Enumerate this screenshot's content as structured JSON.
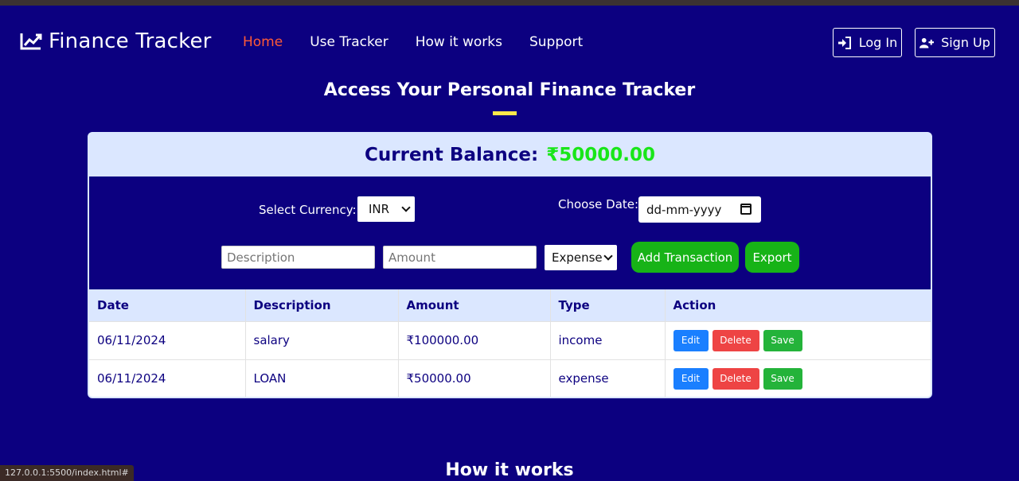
{
  "brand": {
    "title": "Finance Tracker",
    "icon": "chart-line-icon"
  },
  "nav": {
    "items": [
      "Home",
      "Use Tracker",
      "How it works",
      "Support"
    ],
    "active": "Home"
  },
  "auth": {
    "login": "Log In",
    "signup": "Sign Up"
  },
  "page": {
    "heading": "Access Your Personal Finance Tracker"
  },
  "balance": {
    "label": "Current Balance:",
    "value": "₹50000.00"
  },
  "form": {
    "currency_label": "Select Currency:",
    "currency_value": "INR",
    "date_label": "Choose Date:",
    "date_value": "dd-mm-yyyy",
    "description_placeholder": "Description",
    "amount_placeholder": "Amount",
    "type_value": "Expense",
    "add_button": "Add Transaction",
    "export_button": "Export"
  },
  "table": {
    "headers": [
      "Date",
      "Description",
      "Amount",
      "Type",
      "Action"
    ],
    "rows": [
      {
        "date": "06/11/2024",
        "description": "salary",
        "amount": "₹100000.00",
        "type": "income"
      },
      {
        "date": "06/11/2024",
        "description": "LOAN",
        "amount": "₹50000.00",
        "type": "expense"
      }
    ],
    "actions": {
      "edit": "Edit",
      "delete": "Delete",
      "save": "Save"
    }
  },
  "next_section": {
    "heading": "How it works"
  },
  "status_bar": {
    "url": "127.0.0.1:5500/index.html#"
  },
  "colors": {
    "background": "#0c0080",
    "nav_active": "#ff5a36",
    "balance_value": "#19e619",
    "accent_bar": "#ffe94a",
    "button_green": "#17b317",
    "edit": "#1a7fff",
    "delete": "#ee4444",
    "save": "#24b33a"
  }
}
